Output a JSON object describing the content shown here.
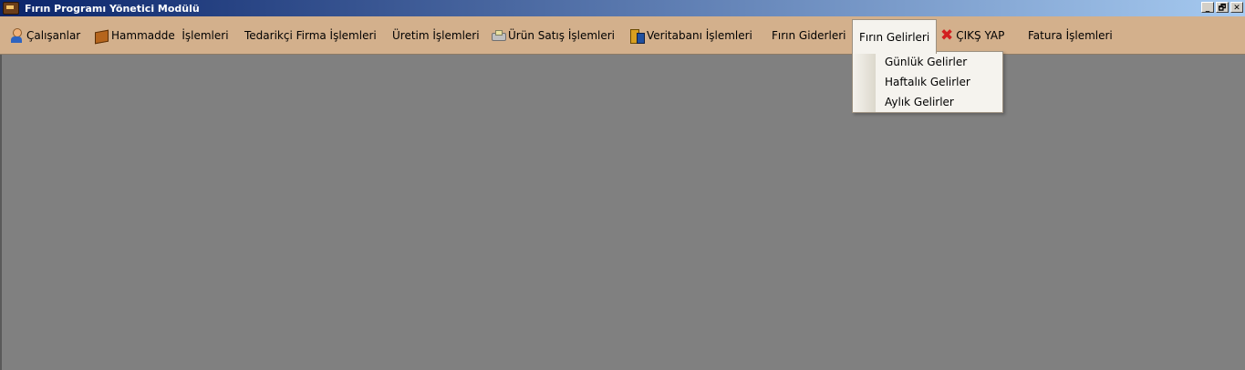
{
  "window": {
    "title": "Fırın Programı Yönetici Modülü",
    "icon": "bread-oven-icon",
    "controls": [
      "_",
      "🗗",
      "✕"
    ]
  },
  "menu": {
    "calisanlar": "Çalışanlar",
    "hammadde": "Hammadde  İşlemleri",
    "tedarikci": "Tedarikçi Firma İşlemleri",
    "uretim": "Üretim İşlemleri",
    "urun_satis": "Ürün Satış İşlemleri",
    "veritabani": "Veritabanı İşlemleri",
    "firin_giderleri": "Fırın Giderleri",
    "firin_gelirleri": "Fırın Gelirleri",
    "cikis": "ÇIKŞ YAP",
    "fatura": "Fatura İşlemleri"
  },
  "dropdown": {
    "open_menu": "Fırın Gelirleri",
    "items": [
      "Günlük Gelirler",
      "Haftalık Gelirler",
      "Aylık Gelirler"
    ]
  },
  "colors": {
    "menubar_bg": "#d3b08c",
    "workspace_bg": "#808080",
    "titlebar_start": "#0a246a",
    "titlebar_end": "#a6caf0"
  }
}
